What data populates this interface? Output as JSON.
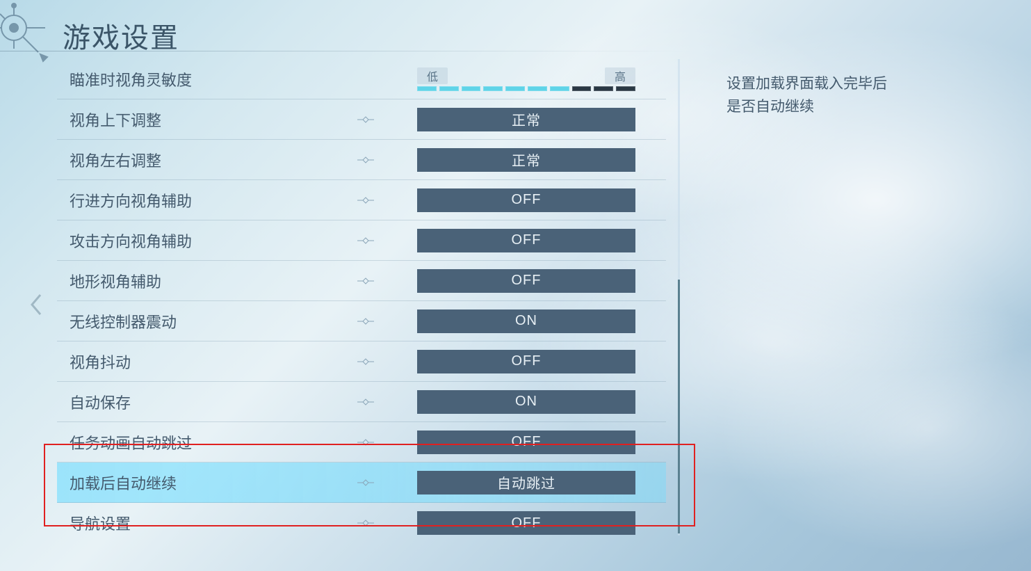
{
  "title": "游戏设置",
  "description": {
    "line1": "设置加载界面载入完毕后",
    "line2": "是否自动继续"
  },
  "slider": {
    "low": "低",
    "high": "高",
    "value": 7,
    "max": 10
  },
  "settings": [
    {
      "label": "瞄准时视角灵敏度",
      "type": "slider"
    },
    {
      "label": "视角上下调整",
      "value": "正常"
    },
    {
      "label": "视角左右调整",
      "value": "正常"
    },
    {
      "label": "行进方向视角辅助",
      "value": "OFF"
    },
    {
      "label": "攻击方向视角辅助",
      "value": "OFF"
    },
    {
      "label": "地形视角辅助",
      "value": "OFF"
    },
    {
      "label": "无线控制器震动",
      "value": "ON"
    },
    {
      "label": "视角抖动",
      "value": "OFF"
    },
    {
      "label": "自动保存",
      "value": "ON"
    },
    {
      "label": "任务动画自动跳过",
      "value": "OFF"
    },
    {
      "label": "加载后自动继续",
      "value": "自动跳过",
      "highlighted": true
    },
    {
      "label": "导航设置",
      "value": "OFF"
    }
  ]
}
